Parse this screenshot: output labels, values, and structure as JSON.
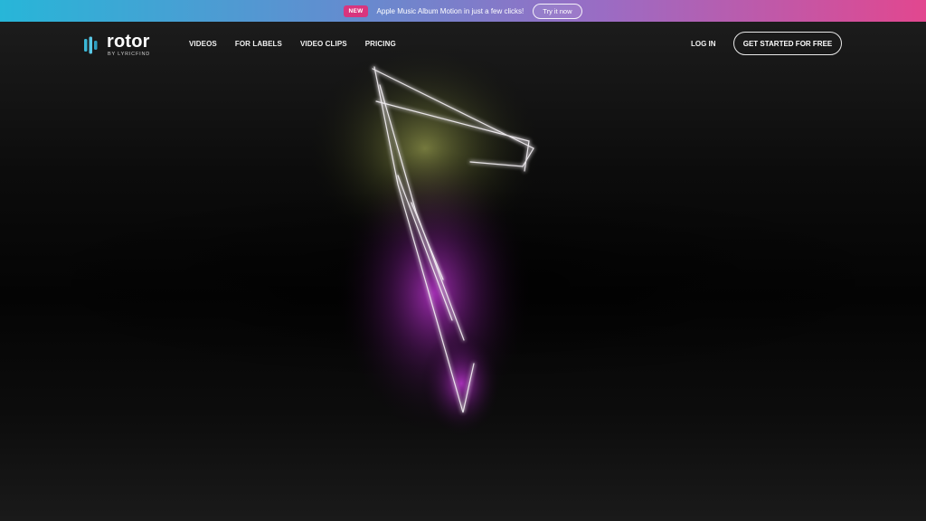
{
  "announcement": {
    "badge": "NEW",
    "text": "Apple Music Album Motion in just a few clicks!",
    "button_label": "Try it now"
  },
  "brand": {
    "name": "rotor",
    "tagline": "BY LYRICFIND"
  },
  "nav": {
    "links": [
      "VIDEOS",
      "FOR LABELS",
      "VIDEO CLIPS",
      "PRICING"
    ],
    "login_label": "LOG IN",
    "cta_label": "GET STARTED FOR FREE"
  },
  "colors": {
    "gradient_start": "#27b6d8",
    "gradient_end": "#e2478f",
    "badge": "#d8357e",
    "logo_mark": "#3ab7d6",
    "glow_yellow": "#b8c25a",
    "glow_magenta": "#c42ad9"
  },
  "icons": {
    "logo": "rotor-bars-icon"
  }
}
